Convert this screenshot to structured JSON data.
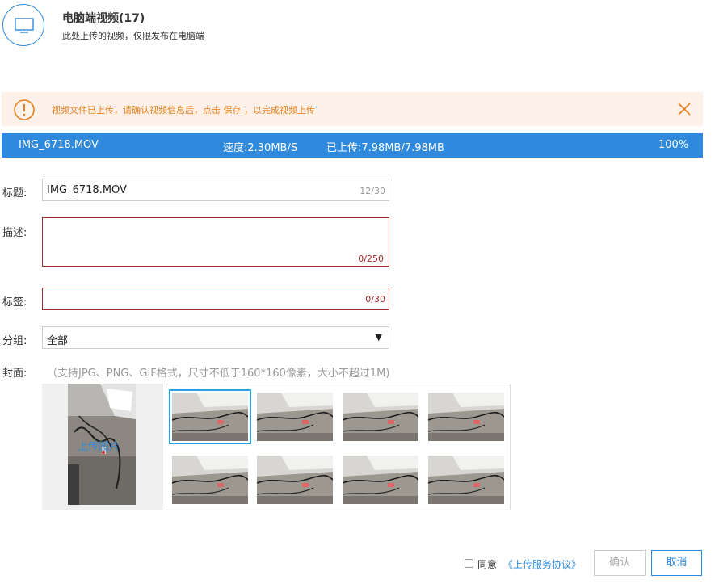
{
  "header": {
    "title": "电脑端视频(17)",
    "subtitle": "此处上传的视频，仅限发布在电脑端",
    "icon": "monitor-icon"
  },
  "notice": {
    "text": "视频文件已上传，请确认视频信息后，点击 保存 ，以完成视频上传",
    "icon": "warning-icon",
    "close_icon": "close-icon"
  },
  "upload": {
    "filename": "IMG_6718.MOV",
    "speed": "速度:2.30MB/S",
    "uploaded": "已上传:7.98MB/7.98MB",
    "percent": "100%",
    "progress_fraction": 1.0
  },
  "form": {
    "title_label": "标题:",
    "title_value": "IMG_6718.MOV",
    "title_count": "12/30",
    "desc_label": "描述:",
    "desc_value": "",
    "desc_count": "0/250",
    "tags_label": "标签:",
    "tags_value": "",
    "tags_count": "0/30",
    "group_label": "分组:",
    "group_value": "全部",
    "cover_label": "封面:",
    "cover_hint": "（支持JPG、PNG、GIF格式，尺寸不低于160*160像素，大小不超过1M)",
    "upload_cover": "上传图片"
  },
  "thumbnails": {
    "count": 8,
    "selected_index": 0
  },
  "footer": {
    "agree_text": "同意",
    "agree_link": "《上传服务协议》",
    "confirm": "确认",
    "cancel": "取消"
  },
  "colors": {
    "accent": "#2f89dc",
    "notice_bg": "#fdf1e9",
    "notice_text": "#e6801c",
    "error": "#a12a2a"
  }
}
